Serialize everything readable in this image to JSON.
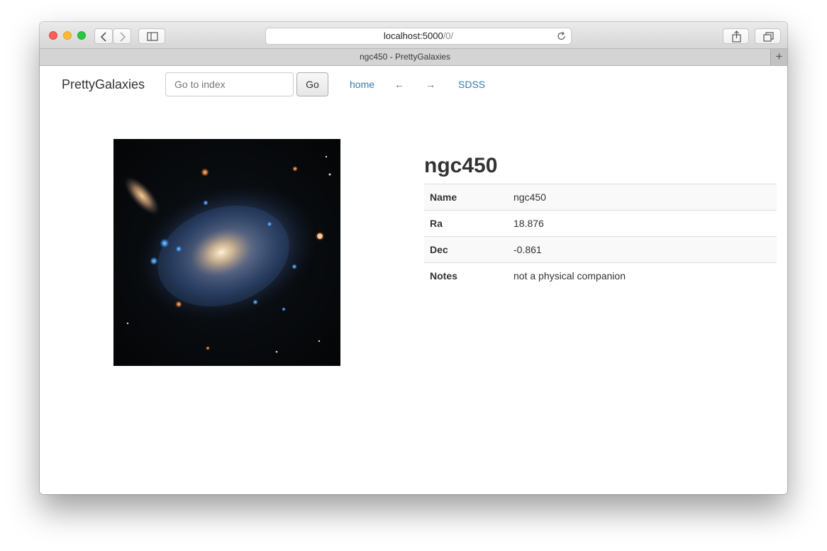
{
  "browser": {
    "url_host": "localhost:5000",
    "url_path": "/0/",
    "tab_title": "ngc450 - PrettyGalaxies",
    "new_tab": "+"
  },
  "navbar": {
    "brand": "PrettyGalaxies",
    "search_placeholder": "Go to index",
    "go_label": "Go",
    "links": {
      "home": "home",
      "prev": "←",
      "next": "→",
      "sdss": "SDSS"
    }
  },
  "galaxy": {
    "title": "ngc450",
    "rows": [
      {
        "key": "Name",
        "value": "ngc450"
      },
      {
        "key": "Ra",
        "value": "18.876"
      },
      {
        "key": "Dec",
        "value": "-0.861"
      },
      {
        "key": "Notes",
        "value": "not a physical companion"
      }
    ]
  },
  "colors": {
    "link": "#337ab7",
    "text": "#333333",
    "stripe": "#f9f9f9"
  }
}
